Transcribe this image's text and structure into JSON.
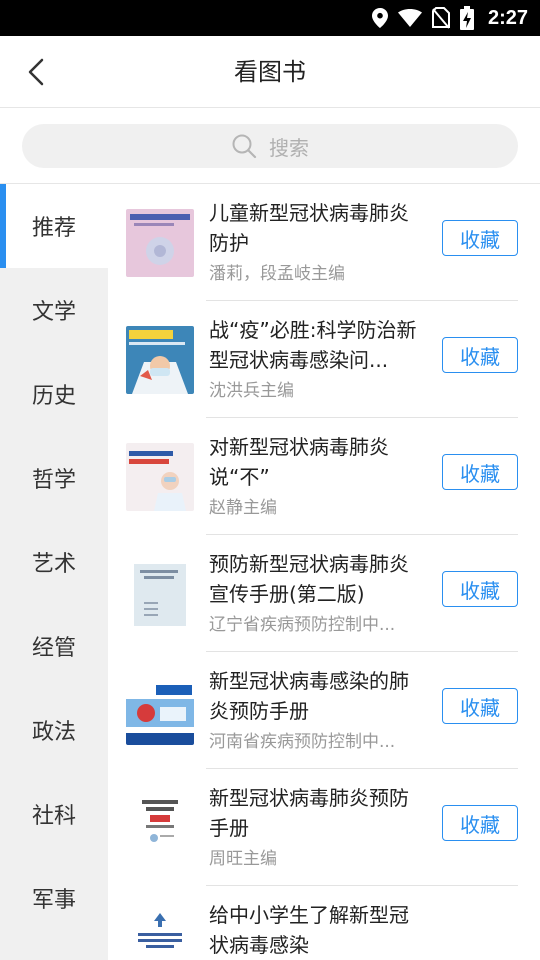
{
  "status_bar": {
    "time": "2:27"
  },
  "header": {
    "title": "看图书"
  },
  "search": {
    "placeholder": "搜索"
  },
  "categories": [
    "推荐",
    "文学",
    "历史",
    "哲学",
    "艺术",
    "经管",
    "政法",
    "社科",
    "军事"
  ],
  "active_category": "推荐",
  "books": [
    {
      "title": "儿童新型冠状病毒肺炎防护",
      "author": "潘莉，段孟岐主编",
      "action": "收藏"
    },
    {
      "title": "战“疫”必胜:科学防治新型冠状病毒感染问...",
      "author": "沈洪兵主编",
      "action": "收藏"
    },
    {
      "title": "对新型冠状病毒肺炎说“不”",
      "author": "赵静主编",
      "action": "收藏"
    },
    {
      "title": "预防新型冠状病毒肺炎宣传手册(第二版)",
      "author": "辽宁省疾病预防控制中...",
      "action": "收藏"
    },
    {
      "title": "新型冠状病毒感染的肺炎预防手册",
      "author": "河南省疾病预防控制中...",
      "action": "收藏"
    },
    {
      "title": "新型冠状病毒肺炎预防手册",
      "author": "周旺主编",
      "action": "收藏"
    },
    {
      "title": "给中小学生了解新型冠状病毒感染",
      "author": "",
      "action": ""
    }
  ],
  "colors": {
    "accent": "#2a8ff0",
    "sidebar_bg": "#f0f0f0",
    "text_secondary": "#999999"
  },
  "icons": {
    "back": "chevron-left-icon",
    "search": "search-icon"
  }
}
